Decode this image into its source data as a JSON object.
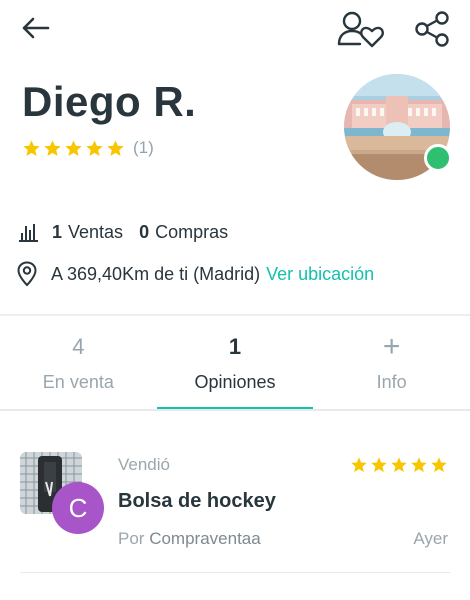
{
  "header": {
    "back_icon": "arrow-left-icon",
    "follow_icon": "user-heart-icon",
    "share_icon": "share-icon"
  },
  "profile": {
    "name": "Diego R.",
    "rating_stars": 5,
    "rating_count": "(1)",
    "online": true,
    "colors": {
      "star": "#f7c600",
      "online": "#2fbf71",
      "accent": "#13c1ac"
    }
  },
  "stats": {
    "sales_count": "1",
    "sales_label": "Ventas",
    "purchases_count": "0",
    "purchases_label": "Compras"
  },
  "location": {
    "text": "A 369,40Km de ti (Madrid)",
    "link": "Ver ubicación"
  },
  "tabs": [
    {
      "count": "4",
      "label": "En venta"
    },
    {
      "count": "1",
      "label": "Opiniones",
      "active": true
    },
    {
      "count": "+",
      "label": "Info"
    }
  ],
  "reviews": [
    {
      "action": "Vendió",
      "stars": 5,
      "title": "Bolsa de hockey",
      "by_prefix": "Por",
      "by_name": "Compraventaa",
      "date": "Ayer",
      "avatar_letter": "C",
      "avatar_color": "#a855c9"
    }
  ]
}
